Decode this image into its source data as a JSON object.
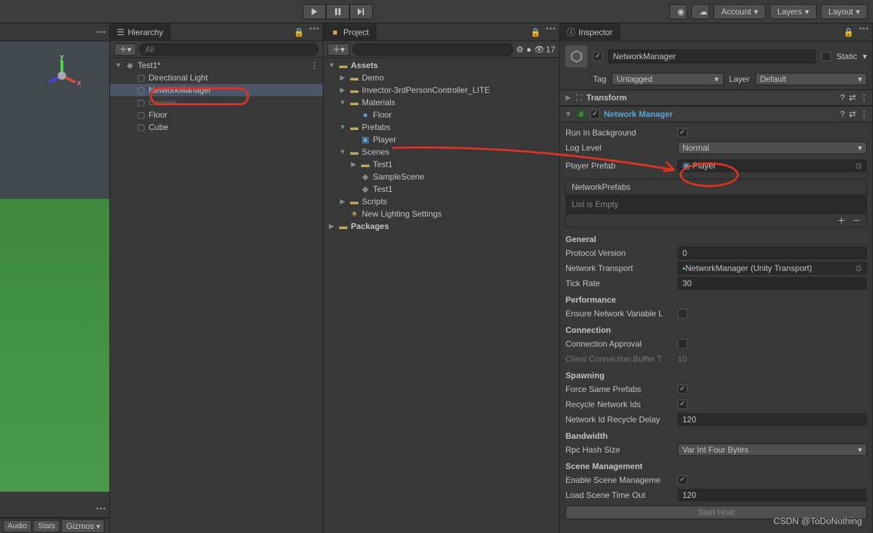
{
  "toolbar": {
    "account": "Account",
    "layers": "Layers",
    "layout": "Layout"
  },
  "hierarchy": {
    "title": "Hierarchy",
    "search_placeholder": "All",
    "items": [
      {
        "label": "Test1*",
        "type": "scene",
        "indent": 0
      },
      {
        "label": "Directional Light",
        "type": "go",
        "indent": 1
      },
      {
        "label": "NetworkManager",
        "type": "go",
        "indent": 1,
        "selected": true
      },
      {
        "label": "Canvas",
        "type": "go",
        "indent": 1,
        "dim": true
      },
      {
        "label": "Floor",
        "type": "go",
        "indent": 1
      },
      {
        "label": "Cube",
        "type": "go",
        "indent": 1
      }
    ]
  },
  "project": {
    "title": "Project",
    "visibility_count": "17",
    "items": [
      {
        "label": "Assets",
        "type": "folder",
        "indent": 0,
        "open": true
      },
      {
        "label": "Demo",
        "type": "folder",
        "indent": 1
      },
      {
        "label": "Invector-3rdPersonController_LITE",
        "type": "folder",
        "indent": 1
      },
      {
        "label": "Materials",
        "type": "folder",
        "indent": 1,
        "open": true
      },
      {
        "label": "Floor",
        "type": "mat",
        "indent": 2
      },
      {
        "label": "Prefabs",
        "type": "folder",
        "indent": 1,
        "open": true
      },
      {
        "label": "Player",
        "type": "prefab",
        "indent": 2
      },
      {
        "label": "Scenes",
        "type": "folder",
        "indent": 1,
        "open": true
      },
      {
        "label": "Test1",
        "type": "folder",
        "indent": 2
      },
      {
        "label": "SampleScene",
        "type": "scene",
        "indent": 2
      },
      {
        "label": "Test1",
        "type": "scene",
        "indent": 2
      },
      {
        "label": "Scripts",
        "type": "folder",
        "indent": 1
      },
      {
        "label": "New Lighting Settings",
        "type": "light",
        "indent": 1
      },
      {
        "label": "Packages",
        "type": "folder",
        "indent": 0
      }
    ]
  },
  "scene_tabs": {
    "audio": "Audio",
    "stats": "Stats",
    "gizmos": "Gizmos"
  },
  "inspector": {
    "title": "Inspector",
    "go_name": "NetworkManager",
    "static": "Static",
    "tag_label": "Tag",
    "tag_value": "Untagged",
    "layer_label": "Layer",
    "layer_value": "Default",
    "transform": "Transform",
    "network_manager": "Network Manager",
    "props": {
      "run_bg": "Run In Background",
      "log_level": "Log Level",
      "log_level_val": "Normal",
      "player_prefab": "Player Prefab",
      "player_prefab_val": "Player",
      "net_prefabs": "NetworkPrefabs",
      "list_empty": "List is Empty",
      "general": "General",
      "proto_ver": "Protocol Version",
      "proto_ver_val": "0",
      "net_transport": "Network Transport",
      "net_transport_val": "NetworkManager (Unity Transport)",
      "tick_rate": "Tick Rate",
      "tick_rate_val": "30",
      "performance": "Performance",
      "ensure_var": "Ensure Network Variable L",
      "connection": "Connection",
      "conn_approval": "Connection Approval",
      "client_buffer": "Client Connection Buffer T",
      "client_buffer_val": "10",
      "spawning": "Spawning",
      "force_prefabs": "Force Same Prefabs",
      "recycle_ids": "Recycle Network Ids",
      "recycle_delay": "Network Id Recycle Delay",
      "recycle_delay_val": "120",
      "bandwidth": "Bandwidth",
      "rpc_hash": "Rpc Hash Size",
      "rpc_hash_val": "Var Int Four Bytes",
      "scene_mgmt": "Scene Management",
      "enable_scene": "Enable Scene Manageme",
      "load_timeout": "Load Scene Time Out",
      "load_timeout_val": "120",
      "start_host": "Start Host"
    }
  },
  "watermark": "CSDN @ToDoNothing"
}
